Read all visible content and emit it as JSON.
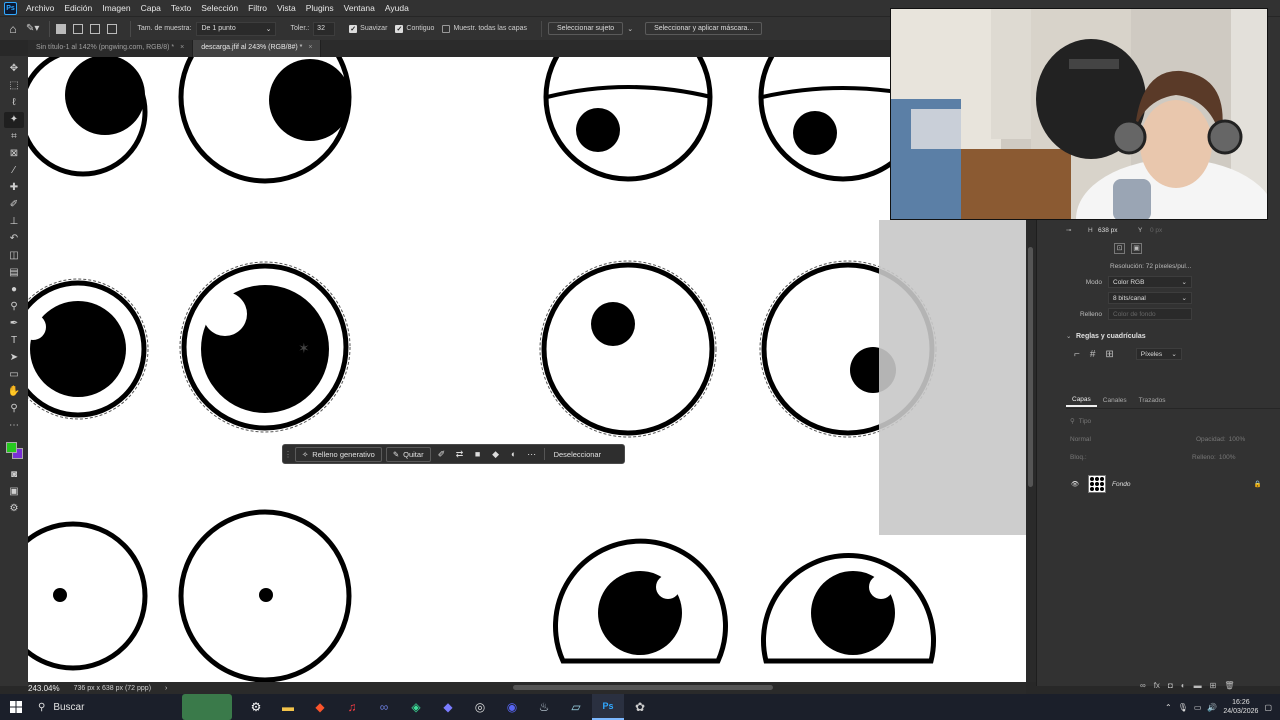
{
  "app": {
    "logo": "Ps"
  },
  "menu": [
    "Archivo",
    "Edición",
    "Imagen",
    "Capa",
    "Texto",
    "Selección",
    "Filtro",
    "Vista",
    "Plugins",
    "Ventana",
    "Ayuda"
  ],
  "options": {
    "sample_size_label": "Tam. de muestra:",
    "sample_size_value": "De 1 punto",
    "tolerance_label": "Toler.:",
    "tolerance_value": "32",
    "antialias_label": "Suavizar",
    "contiguous_label": "Contiguo",
    "all_layers_label": "Muestr. todas las capas",
    "select_subject": "Seleccionar sujeto",
    "select_mask": "Seleccionar y aplicar máscara..."
  },
  "tabs": [
    {
      "label": "Sin título-1 al 142% (pngwing.com, RGB/8) *",
      "active": false
    },
    {
      "label": "descarga.jfif al 243% (RGB/8#) *",
      "active": true
    }
  ],
  "status": {
    "zoom": "243.04%",
    "doc_info": "736 px x 638 px (72 ppp)"
  },
  "context_bar": {
    "generative_fill": "Relleno generativo",
    "remove": "Quitar",
    "deselect": "Deseleccionar"
  },
  "properties": {
    "h_label": "H",
    "h_value": "638 px",
    "y_label": "Y",
    "y_value": "0 px",
    "resolution": "Resolución: 72 píxeles/pul...",
    "mode_label": "Modo",
    "mode_value": "Color RGB",
    "bits_value": "8 bits/canal",
    "fill_label": "Relleno",
    "fill_value": "Color de fondo",
    "rulers_header": "Reglas y cuadrículas",
    "units_value": "Píxeles"
  },
  "layers_panel": {
    "tabs": [
      "Capas",
      "Canales",
      "Trazados"
    ],
    "search_placeholder": "Tipo",
    "blend_mode": "Normal",
    "opacity_label": "Opacidad:",
    "opacity_value": "100%",
    "lock_label": "Bloq.:",
    "fill_label": "Relleno:",
    "fill_value": "100%",
    "layer_name": "Fondo"
  },
  "taskbar": {
    "search_label": "Buscar",
    "time": "16:26",
    "date": "24/03/2026"
  },
  "colors": {
    "foreground": "#26c81f",
    "background": "#7a2fd6",
    "accent": "#31a8ff"
  }
}
